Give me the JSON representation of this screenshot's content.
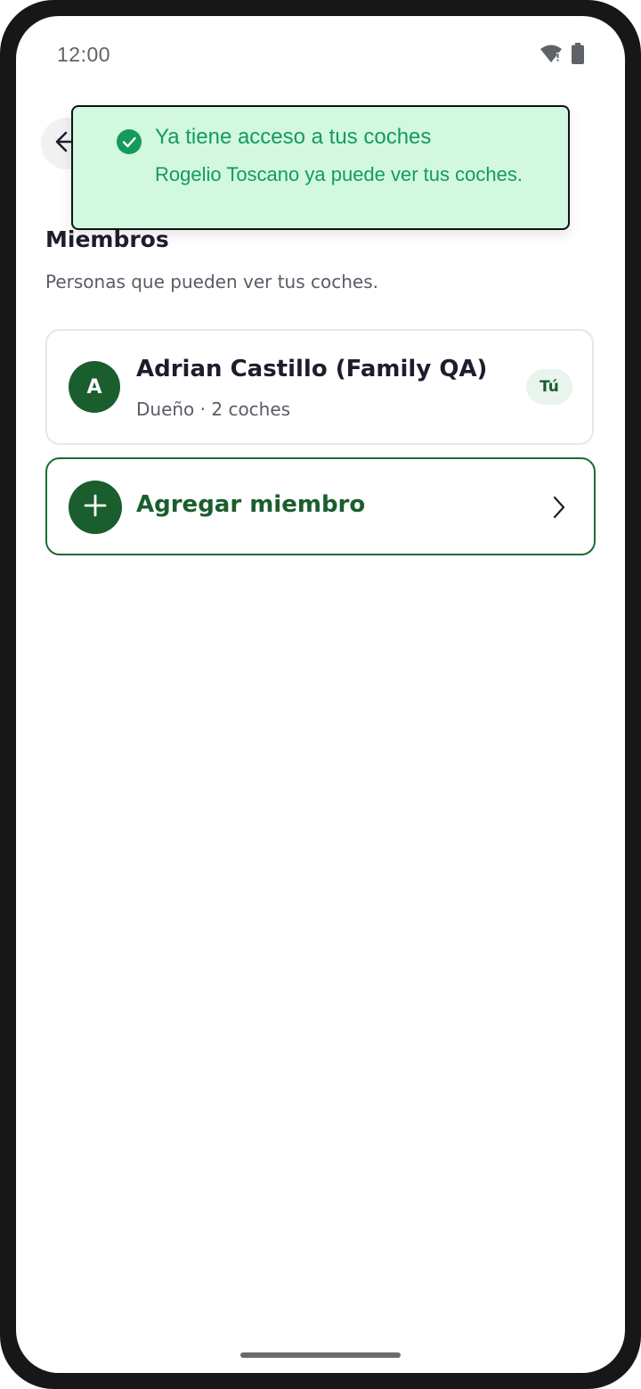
{
  "status_bar": {
    "time": "12:00",
    "icons": [
      "wifi-icon",
      "battery-icon"
    ]
  },
  "toast": {
    "title": "Ya tiene acceso a tus coches",
    "message": "Rogelio Toscano ya puede ver tus coches.",
    "icon": "check-circle-icon",
    "colors": {
      "background": "#d2f8e0",
      "text": "#149b5c"
    }
  },
  "header": {
    "back_icon": "arrow-left-icon"
  },
  "members": {
    "title": "Miembros",
    "subtitle": "Personas que pueden ver tus coches.",
    "items": [
      {
        "avatar_initial": "A",
        "name": "Adrian Castillo (Family QA)",
        "meta": "Dueño · 2 coches",
        "badge": "Tú"
      }
    ]
  },
  "add_member": {
    "label": "Agregar miembro",
    "icon": "plus-icon",
    "chevron": "chevron-right-icon"
  },
  "colors": {
    "primary": "#1a5e2e",
    "accent_success": "#149b5c"
  }
}
